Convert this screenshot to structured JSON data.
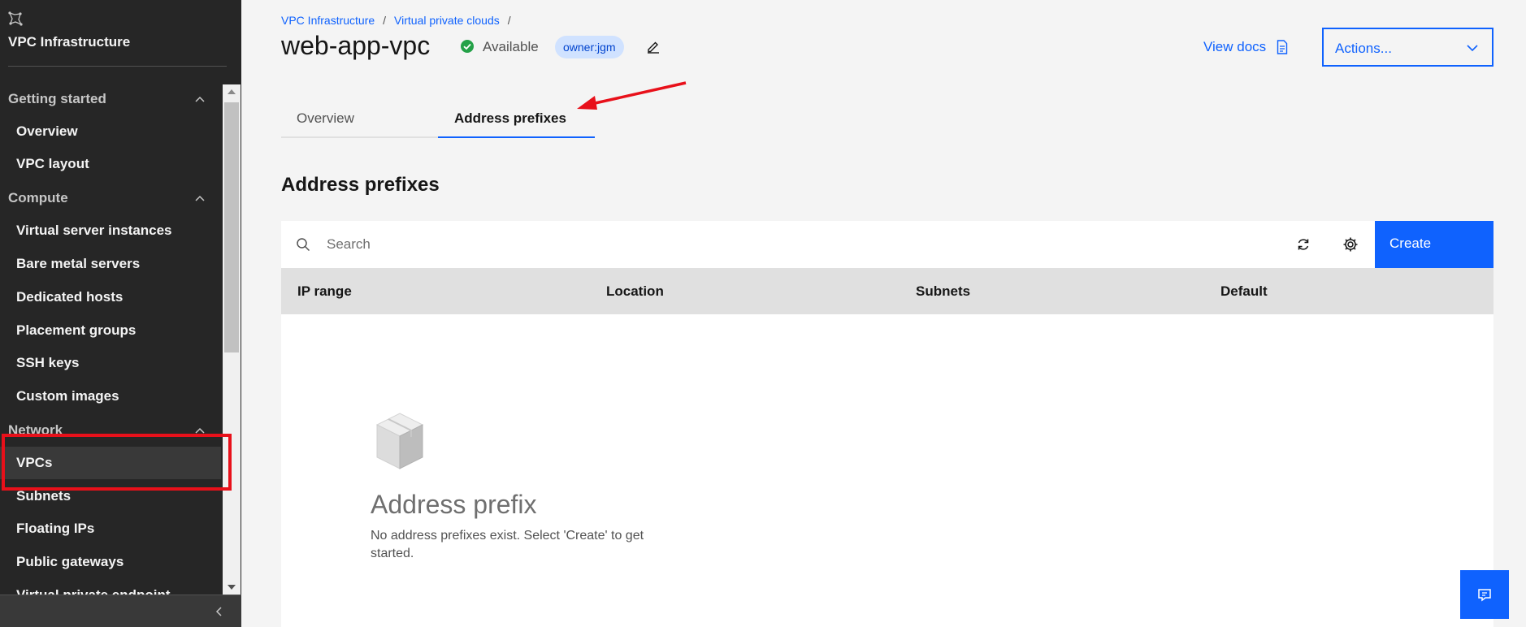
{
  "sidebar": {
    "title": "VPC Infrastructure",
    "categories": [
      {
        "label": "Getting started"
      },
      {
        "label": "Compute"
      },
      {
        "label": "Network"
      }
    ],
    "items": [
      {
        "label": "Overview"
      },
      {
        "label": "VPC layout"
      },
      {
        "label": "Virtual server instances"
      },
      {
        "label": "Bare metal servers"
      },
      {
        "label": "Dedicated hosts"
      },
      {
        "label": "Placement groups"
      },
      {
        "label": "SSH keys"
      },
      {
        "label": "Custom images"
      },
      {
        "label": "VPCs"
      },
      {
        "label": "Subnets"
      },
      {
        "label": "Floating IPs"
      },
      {
        "label": "Public gateways"
      },
      {
        "label": "Virtual private endpoint"
      }
    ],
    "active_item": "VPCs"
  },
  "breadcrumb": {
    "items": [
      "VPC Infrastructure",
      "Virtual private clouds"
    ],
    "separator": "/"
  },
  "header": {
    "title": "web-app-vpc",
    "status": "Available",
    "tag": "owner:jgm",
    "view_docs": "View docs",
    "actions_label": "Actions..."
  },
  "tabs": [
    {
      "label": "Overview",
      "selected": false
    },
    {
      "label": "Address prefixes",
      "selected": true
    }
  ],
  "section": {
    "title": "Address prefixes"
  },
  "toolbar": {
    "search_placeholder": "Search",
    "create_label": "Create"
  },
  "table": {
    "columns": [
      "IP range",
      "Location",
      "Subnets",
      "Default"
    ],
    "rows": []
  },
  "empty_state": {
    "title": "Address prefix",
    "description": "No address prefixes exist. Select 'Create' to get started."
  },
  "colors": {
    "accent": "#0f62fe",
    "sidebar_bg": "#262626",
    "annotation_red": "#e8101a",
    "status_green": "#24a148",
    "tag_bg": "#d0e2ff"
  },
  "icons": [
    "app-logo-icon",
    "chevron-up-icon",
    "checkmark-filled-icon",
    "edit-icon",
    "document-icon",
    "chevron-down-icon",
    "search-icon",
    "refresh-icon",
    "settings-icon",
    "empty-box-icon",
    "chat-icon",
    "chevron-left-icon"
  ]
}
